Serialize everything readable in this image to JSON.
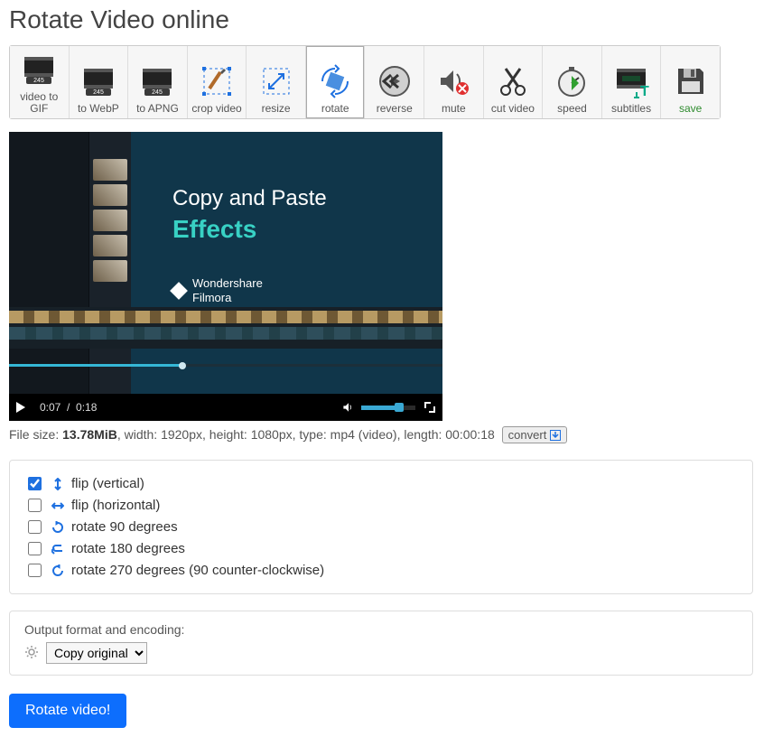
{
  "title": "Rotate Video online",
  "toolbar": [
    {
      "id": "video-to-gif",
      "label": "video to\nGIF"
    },
    {
      "id": "to-webp",
      "label": "to WebP"
    },
    {
      "id": "to-apng",
      "label": "to APNG"
    },
    {
      "id": "crop-video",
      "label": "crop video"
    },
    {
      "id": "resize",
      "label": "resize"
    },
    {
      "id": "rotate",
      "label": "rotate",
      "active": true
    },
    {
      "id": "reverse",
      "label": "reverse"
    },
    {
      "id": "mute",
      "label": "mute"
    },
    {
      "id": "cut-video",
      "label": "cut video"
    },
    {
      "id": "speed",
      "label": "speed"
    },
    {
      "id": "subtitles",
      "label": "subtitles"
    },
    {
      "id": "save",
      "label": "save"
    }
  ],
  "preview": {
    "headline1": "Copy and Paste",
    "headline2": "Effects",
    "brand1": "Wondershare",
    "brand2": "Filmora",
    "time_current": "0:07",
    "time_total": "0:18"
  },
  "fileinfo": {
    "prefix": "File size: ",
    "size": "13.78MiB",
    "rest": ", width: 1920px, height: 1080px, type: mp4 (video), length: 00:00:18",
    "convert_label": "convert"
  },
  "options": [
    {
      "id": "flip-vertical",
      "label": "flip (vertical)",
      "checked": true
    },
    {
      "id": "flip-horizontal",
      "label": "flip (horizontal)",
      "checked": false
    },
    {
      "id": "rotate-90",
      "label": "rotate 90 degrees",
      "checked": false
    },
    {
      "id": "rotate-180",
      "label": "rotate 180 degrees",
      "checked": false
    },
    {
      "id": "rotate-270",
      "label": "rotate 270 degrees (90 counter-clockwise)",
      "checked": false
    }
  ],
  "encoding": {
    "label": "Output format and encoding:",
    "selected": "Copy original"
  },
  "action_button": "Rotate video!"
}
